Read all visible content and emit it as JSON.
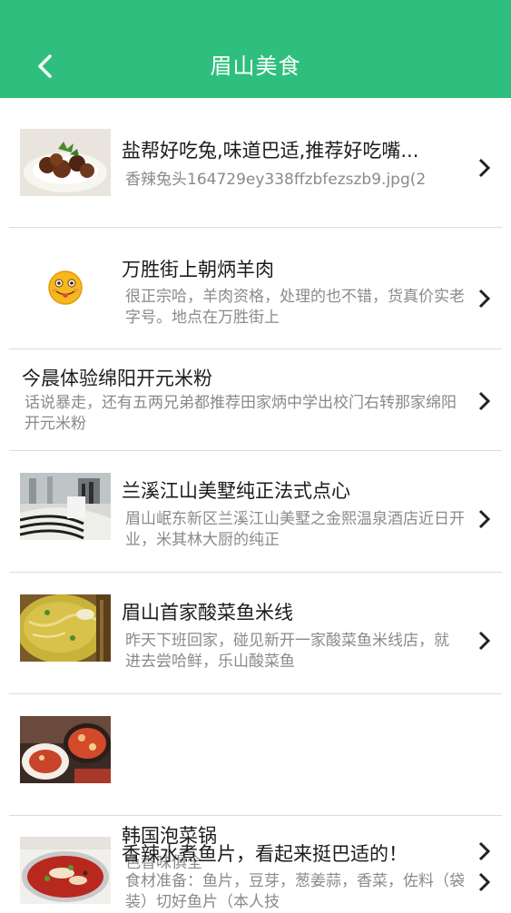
{
  "header": {
    "title": "眉山美食",
    "back_icon": "chevron-left-icon",
    "background_color": "#2ebf7e"
  },
  "items": [
    {
      "title": "盐帮好吃兔,味道巴适,推荐好吃嘴...",
      "description": "香辣兔头164729ey338ffzbfezszb9.jpg(2",
      "thumbnail": "spicy-rabbit-dish-image"
    },
    {
      "title": "万胜街上朝炳羊肉",
      "description": "很正宗哈，羊肉资格，处理的也不错，货真价实老字号。地点在万胜街上",
      "thumbnail": "tongue-out-emoji"
    },
    {
      "title": "今晨体验绵阳开元米粉",
      "description": "话说暴走，还有五两兄弟都推荐田家炳中学出校门右转那家绵阳开元米粉"
    },
    {
      "title": "兰溪江山美墅纯正法式点心",
      "description": "眉山岷东新区兰溪江山美墅之金熙温泉酒店近日开业，米其林大厨的纯正",
      "thumbnail": "hotel-lobby-image"
    },
    {
      "title": "眉山首家酸菜鱼米线",
      "description": "昨天下班回家，碰见新开一家酸菜鱼米线店，就进去尝哈鲜，乐山酸菜鱼",
      "thumbnail": "pickled-fish-noodle-image"
    },
    {
      "title": "韩国泡菜锅",
      "description": "色香味俱全",
      "thumbnail": "kimchi-pot-image"
    },
    {
      "title": "香辣水煮鱼片，看起来挺巴适的！",
      "description": "食材准备：鱼片，豆芽，葱姜蒜，香菜，佐料（袋装）切好鱼片（本人技",
      "thumbnail": "boiled-fish-image"
    }
  ]
}
